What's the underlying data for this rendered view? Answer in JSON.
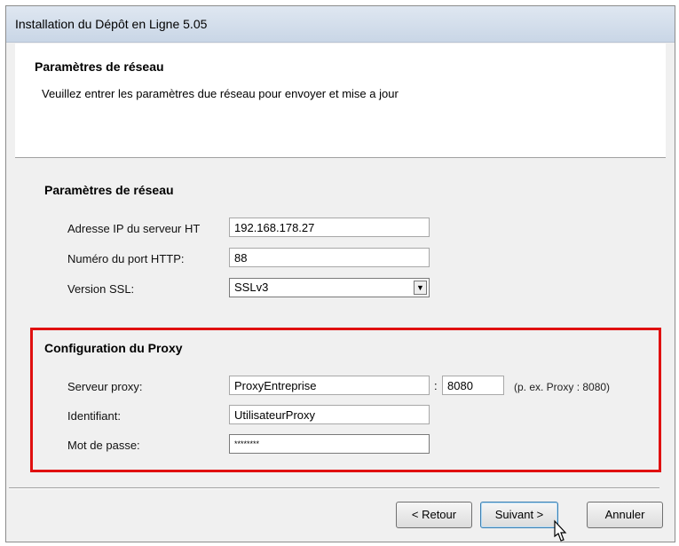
{
  "window": {
    "title": "Installation du Dépôt en Ligne 5.05"
  },
  "header": {
    "title": "Paramètres de réseau",
    "description": "Veuillez entrer les paramètres due réseau pour envoyer et mise a jour"
  },
  "network": {
    "group_title": "Paramètres de réseau",
    "ip_label": "Adresse IP du serveur HT",
    "ip_value": "192.168.178.27",
    "port_label": "Numéro du port HTTP:",
    "port_value": "88",
    "ssl_label": "Version SSL:",
    "ssl_value": "SSLv3"
  },
  "proxy": {
    "group_title": "Configuration du Proxy",
    "server_label": "Serveur proxy:",
    "server_value": "ProxyEntreprise",
    "colon": ":",
    "port_value": "8080",
    "hint": "(p. ex. Proxy : 8080)",
    "user_label": "Identifiant:",
    "user_value": "UtilisateurProxy",
    "password_label": "Mot de passe:",
    "password_value": "********"
  },
  "buttons": {
    "back": "< Retour",
    "next": "Suivant >",
    "cancel": "Annuler"
  },
  "colors": {
    "highlight": "#e01010"
  }
}
